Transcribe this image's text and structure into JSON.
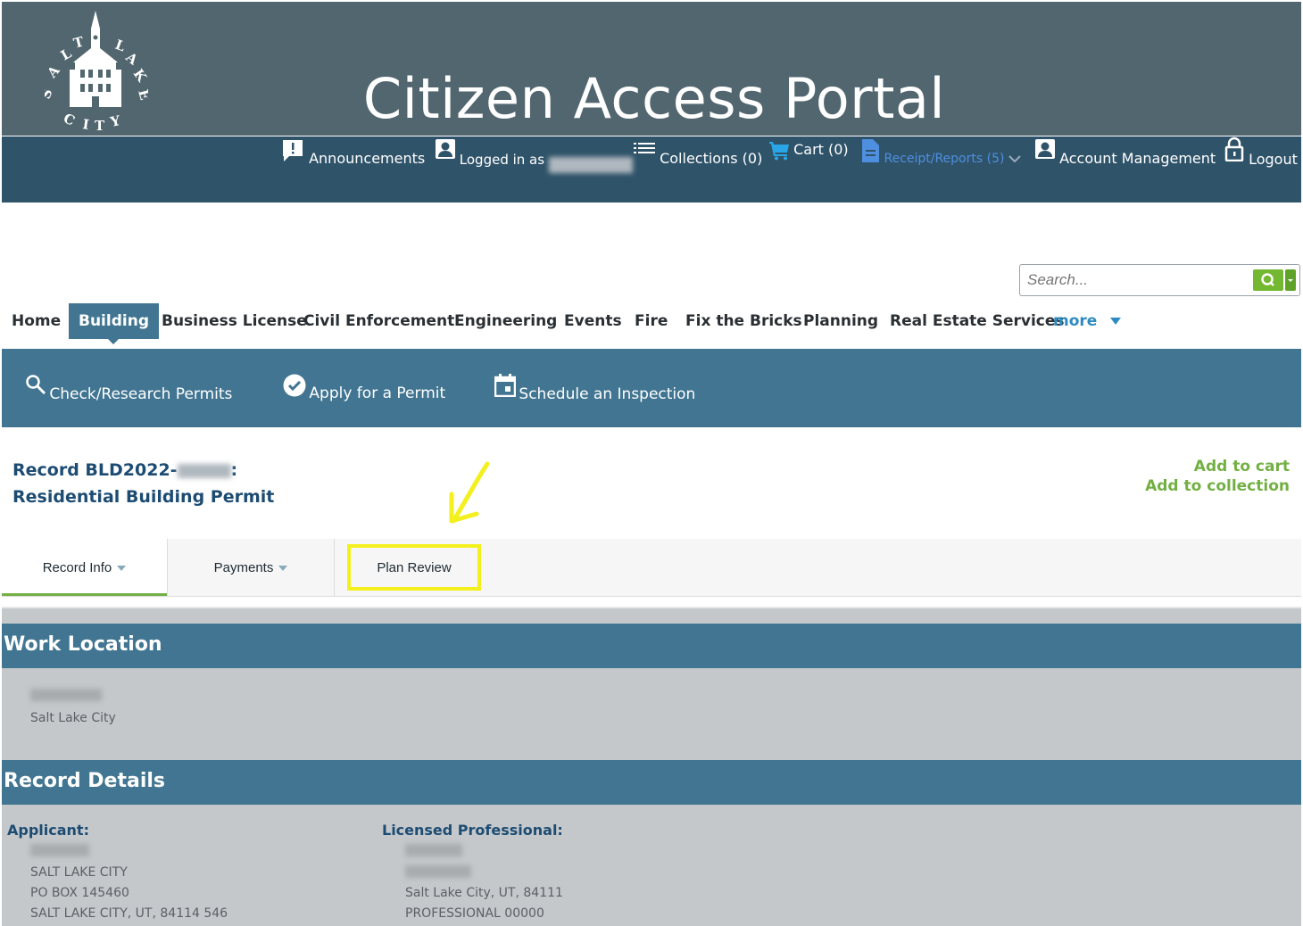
{
  "header": {
    "title": "Citizen Access Portal",
    "logo_text": "SALT LAKE CITY"
  },
  "topbar": {
    "announcements": "Announcements",
    "logged_in": "Logged in as",
    "collections": "Collections (0)",
    "cart": "Cart (0)",
    "receipts": "Receipt/Reports (5)",
    "account": "Account Management",
    "logout": "Logout"
  },
  "search": {
    "placeholder": "Search..."
  },
  "nav": {
    "items": [
      "Home",
      "Building",
      "Business License",
      "Civil Enforcement",
      "Engineering",
      "Events",
      "Fire",
      "Fix the Bricks",
      "Planning",
      "Real Estate Services"
    ],
    "more": "more",
    "active": "Building"
  },
  "subnav": {
    "check": "Check/Research Permits",
    "apply": "Apply for a Permit",
    "schedule": "Schedule an Inspection"
  },
  "record": {
    "prefix": "Record BLD2022-",
    "suffix": ":",
    "type": "Residential Building Permit",
    "add_cart": "Add to cart",
    "add_collection": "Add to collection"
  },
  "tabs": {
    "record_info": "Record Info",
    "payments": "Payments",
    "plan_review": "Plan Review"
  },
  "work_location": {
    "heading": "Work Location",
    "city": "Salt Lake City"
  },
  "record_details": {
    "heading": "Record Details",
    "applicant_label": "Applicant:",
    "applicant_lines": [
      "SALT LAKE CITY",
      "PO BOX 145460",
      "SALT LAKE CITY, UT, 84114 546"
    ],
    "professional_label": "Licensed Professional:",
    "professional_lines": [
      "Salt Lake City, UT, 84111",
      "PROFESSIONAL 00000"
    ]
  },
  "colors": {
    "banner": "#52666f",
    "topbar": "#2f5369",
    "accent": "#417591",
    "green": "#72b043",
    "highlight": "#f3f01d"
  }
}
